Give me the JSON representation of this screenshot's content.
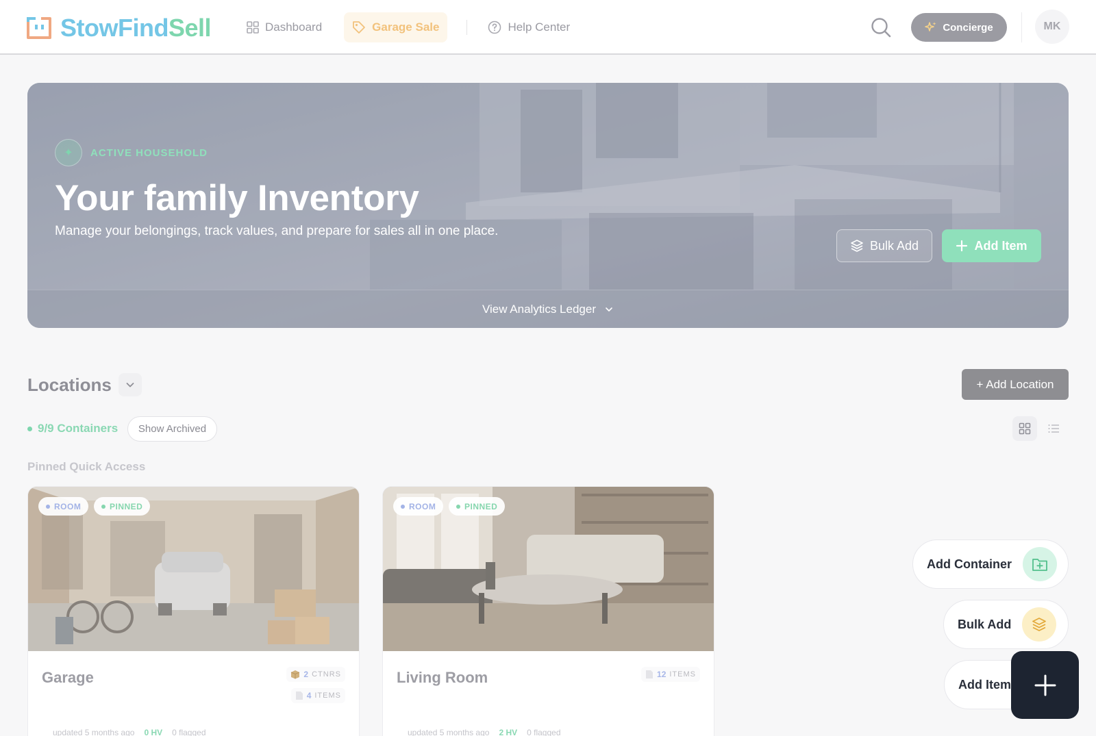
{
  "brand": {
    "name_part1": "StowFind",
    "name_part2": "Sell"
  },
  "nav": {
    "dashboard": "Dashboard",
    "garage_sale": "Garage Sale",
    "help_center": "Help Center"
  },
  "header": {
    "concierge": "Concierge",
    "avatar_initials": "MK"
  },
  "hero": {
    "badge": "ACTIVE HOUSEHOLD",
    "title": "Your family Inventory",
    "subtitle": "Manage your belongings, track values, and prepare for sales all in one place.",
    "bulk_add": "Bulk Add",
    "add_item": "Add Item",
    "analytics": "View Analytics Ledger"
  },
  "locations": {
    "title": "Locations",
    "add_location": "+ Add Location",
    "containers": "9/9 Containers",
    "show_archived": "Show Archived",
    "pinned_label": "Pinned Quick Access"
  },
  "cards": [
    {
      "name": "Garage",
      "tag_room": "ROOM",
      "tag_pinned": "PINNED",
      "containers_count": "2",
      "containers_label": "CTNRS",
      "items_count": "4",
      "items_label": "ITEMS",
      "updated": "updated 5 months ago",
      "hv": "0 HV",
      "flagged": "0 flagged"
    },
    {
      "name": "Living Room",
      "tag_room": "ROOM",
      "tag_pinned": "PINNED",
      "items_count": "12",
      "items_label": "ITEMS",
      "updated": "updated 5 months ago",
      "hv": "2 HV",
      "flagged": "0 flagged"
    }
  ],
  "fab": {
    "add_container": "Add Container",
    "bulk_add": "Bulk Add",
    "add_item": "Add Item"
  },
  "colors": {
    "brand_blue": "#74c6e6",
    "brand_green": "#7ed6ae",
    "accent_orange": "#f2c27c",
    "fab_dark": "#1d2431"
  }
}
